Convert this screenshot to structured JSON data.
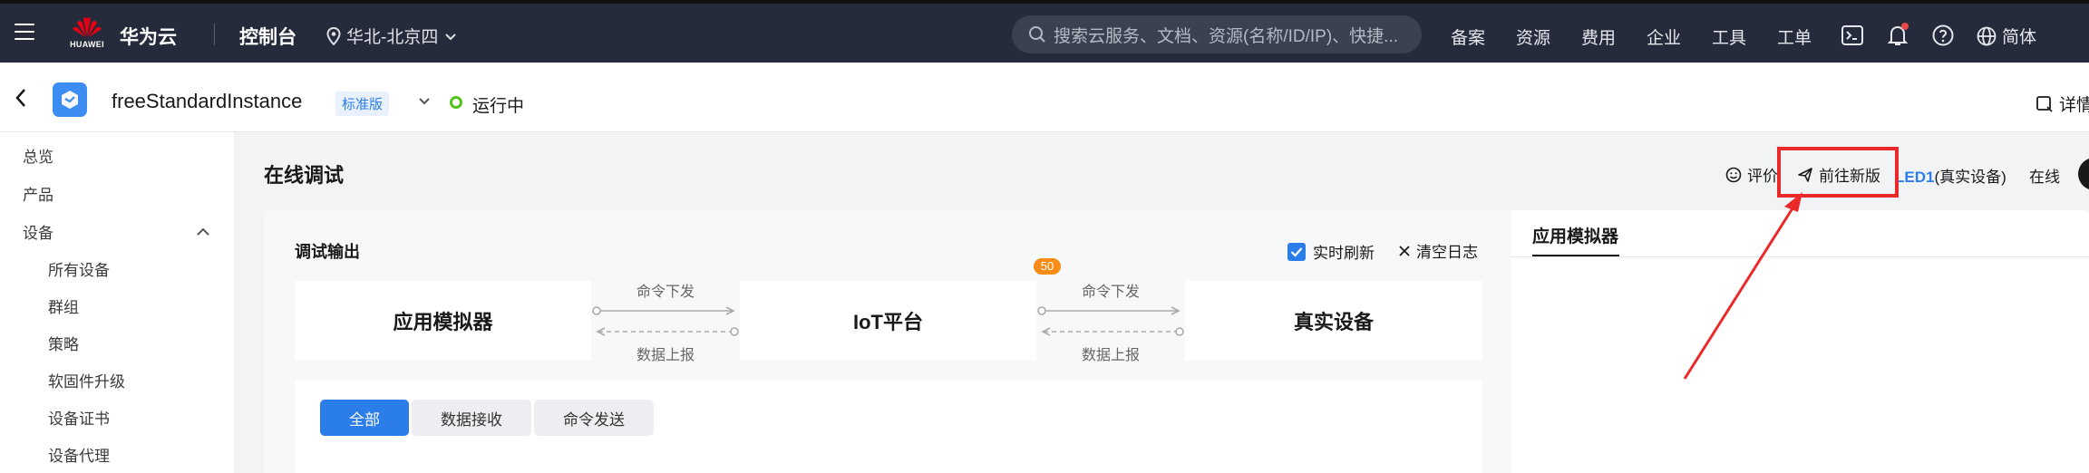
{
  "topbar": {
    "logo_text": "HUAWEI",
    "brand": "华为云",
    "console": "控制台",
    "region": "华北-北京四",
    "search_placeholder": "搜索云服务、文档、资源(名称/ID/IP)、快捷...",
    "nav": [
      "备案",
      "资源",
      "费用",
      "企业",
      "工具",
      "工单"
    ],
    "lang": "简体"
  },
  "instance": {
    "name": "freeStandardInstance",
    "edition": "标准版",
    "status": "运行中",
    "detail": "详情"
  },
  "sidebar": {
    "items": [
      "总览",
      "产品",
      "设备"
    ],
    "sub_items": [
      "所有设备",
      "群组",
      "策略",
      "软固件升级",
      "设备证书",
      "设备代理"
    ]
  },
  "main": {
    "title": "在线调试",
    "rate": "评价",
    "goto_new": "前往新版",
    "device_name": "LED1",
    "device_suffix": "(真实设备)",
    "online": "在线",
    "debug_output": "调试输出",
    "realtime_refresh": "实时刷新",
    "clear_log": "清空日志",
    "flow": {
      "app_sim": "应用模拟器",
      "iot": "IoT平台",
      "real": "真实设备",
      "cmd_down_1": "命令下发",
      "data_up_1": "数据上报",
      "cmd_down_2": "命令下发",
      "data_up_2": "数据上报",
      "badge": "50"
    },
    "tabs": [
      "全部",
      "数据接收",
      "命令发送"
    ],
    "right_tab": "应用模拟器"
  },
  "colors": {
    "topbar_bg": "#252b3a",
    "accent": "#2b7de9",
    "status_green": "#52c41a",
    "annotation_red": "#ea2a2a",
    "badge_orange": "#fa8c16"
  },
  "icons": [
    "menu-icon",
    "huawei-logo-icon",
    "location-pin-icon",
    "chevron-down-icon",
    "search-icon",
    "terminal-icon",
    "bell-icon",
    "help-icon",
    "globe-icon",
    "back-arrow-icon",
    "instance-cube-icon",
    "detail-icon",
    "chevron-up-icon",
    "smile-icon",
    "send-icon",
    "check-icon",
    "close-icon"
  ]
}
